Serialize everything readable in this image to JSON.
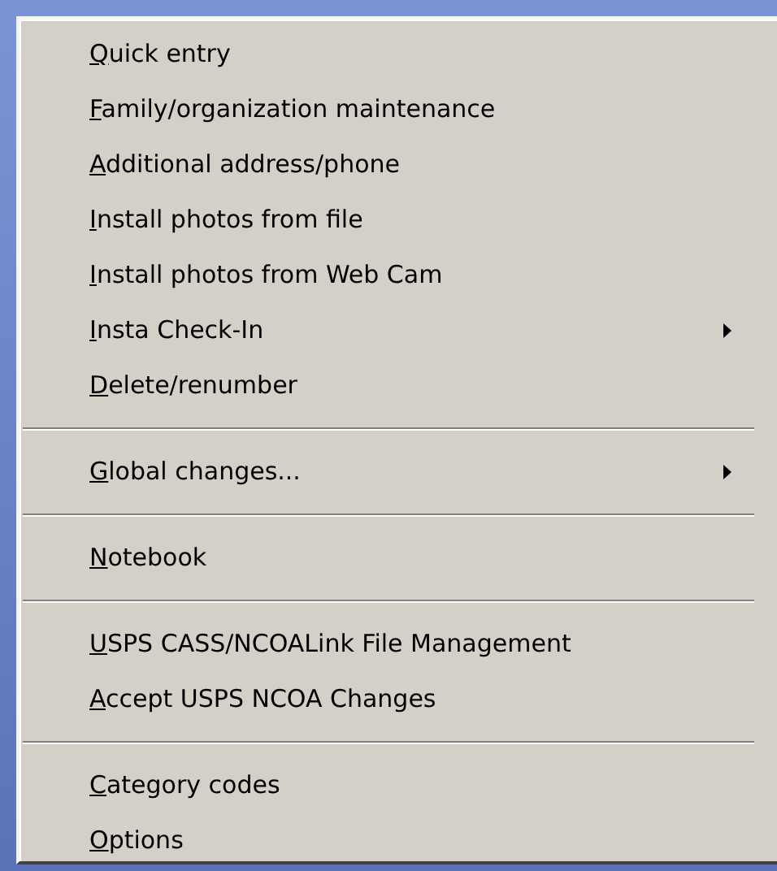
{
  "menu": {
    "items": [
      {
        "kind": "item",
        "label": "Quick entry",
        "submenu": false
      },
      {
        "kind": "item",
        "label": "Family/organization maintenance",
        "submenu": false
      },
      {
        "kind": "item",
        "label": "Additional address/phone",
        "submenu": false
      },
      {
        "kind": "item",
        "label": "Install photos from file",
        "submenu": false
      },
      {
        "kind": "item",
        "label": "Install photos from Web Cam",
        "submenu": false
      },
      {
        "kind": "item",
        "label": "Insta Check-In",
        "submenu": true
      },
      {
        "kind": "item",
        "label": "Delete/renumber",
        "submenu": false
      },
      {
        "kind": "separator"
      },
      {
        "kind": "item",
        "label": "Global changes...",
        "submenu": true
      },
      {
        "kind": "separator"
      },
      {
        "kind": "item",
        "label": "Notebook",
        "submenu": false
      },
      {
        "kind": "separator"
      },
      {
        "kind": "item",
        "label": "USPS CASS/NCOALink File Management",
        "submenu": false
      },
      {
        "kind": "item",
        "label": "Accept USPS NCOA Changes",
        "submenu": false
      },
      {
        "kind": "separator"
      },
      {
        "kind": "item",
        "label": "Category codes",
        "submenu": false
      },
      {
        "kind": "item",
        "label": "Options",
        "submenu": false
      }
    ]
  }
}
